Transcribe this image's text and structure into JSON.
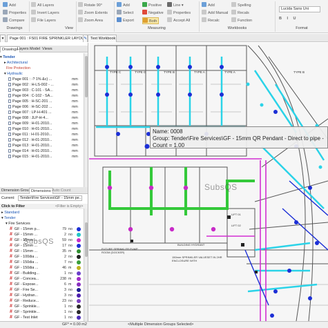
{
  "ribbon": {
    "col1": [
      "Add",
      "Properties",
      "Compare"
    ],
    "col2": [
      "All Layers",
      "Invert Layers",
      "File Layers"
    ],
    "col3": [
      "Rotate 90°",
      "Zoom Extents",
      "Zoom Area"
    ],
    "col4": [
      "Add",
      "Select",
      "Export"
    ],
    "col5": [
      "Positive",
      "Negative",
      "Both"
    ],
    "col6": [
      "Line",
      "Properties",
      "Accept All"
    ],
    "col7": [
      "Add",
      "Add Manual",
      "Recalc"
    ],
    "col8": [
      "Spelling",
      "Recals",
      "Function"
    ],
    "font_name": "Lucida Sans Uni",
    "groups": [
      "Drawings",
      "View",
      "Measuring",
      "Workbooks",
      "Format"
    ]
  },
  "tabs": [
    "Page 001 : FS01 FIRE SPRINKLER LAYOUT G...",
    "Text Workbook"
  ],
  "left_panel": {
    "top_tabs": [
      "Drawings",
      "Layers",
      "Model",
      "Views"
    ],
    "tree": {
      "root": "Tender",
      "folders": [
        "Architectural",
        "Fire Protection",
        "Hydraulic"
      ],
      "pages": [
        {
          "label": "Page 001 : ‑? 1% &c) ...",
          "unit": "mm"
        },
        {
          "label": "Page 002 : H‑LS‑002 ‑ ...",
          "unit": "mm"
        },
        {
          "label": "Page 003 : C‑101 ‑ SA...",
          "unit": "mm"
        },
        {
          "label": "Page 004 : C‑102 ‑ SA...",
          "unit": "mm"
        },
        {
          "label": "Page 005 : H‑SC‑201 ...",
          "unit": "mm"
        },
        {
          "label": "Page 006 : H‑SC‑202 ...",
          "unit": "mm"
        },
        {
          "label": "Page 007 : LP‑H‑401 ...",
          "unit": "mm"
        },
        {
          "label": "Page 008 : JLP‑H‑4...",
          "unit": "mm"
        },
        {
          "label": "Page 009 : H‑01‑2010...",
          "unit": "mm"
        },
        {
          "label": "Page 010 : H‑01‑2010...",
          "unit": "mm"
        },
        {
          "label": "Page 011 : H‑01‑2010...",
          "unit": "mm"
        },
        {
          "label": "Page 012 : H‑01‑2010...",
          "unit": "mm"
        },
        {
          "label": "Page 013 : H‑01‑2010...",
          "unit": "mm"
        },
        {
          "label": "Page 014 : H‑01‑2010...",
          "unit": "mm"
        },
        {
          "label": "Page 015 : H‑01‑2010...",
          "unit": "mm"
        }
      ]
    },
    "bottom_tabs": [
      "Dimension Groups",
      "Dimensions",
      "Auto Count"
    ],
    "current_label": "Current:",
    "current_value": "Tender\\Fire Services\\GF ‑ 15mm pe...",
    "filter_label": "Click to Filter",
    "filter_placeholder": "<Filter is Empty>",
    "dim_tree": {
      "standard": "Standard",
      "tender": "Tender",
      "fire_services": "Fire Services",
      "items": [
        {
          "label": "GF ‑ 15mm p...",
          "count": "79",
          "unit": "no",
          "color": "#1c2fd6"
        },
        {
          "label": "GF ‑ 15mm ...",
          "count": "2",
          "unit": "no",
          "color": "#23c7c7"
        },
        {
          "label": "GF ‑ 15mm ...",
          "count": "59",
          "unit": "no",
          "color": "#c82bc8"
        },
        {
          "label": "GF ‑ 15mm ...",
          "count": "17",
          "unit": "no",
          "color": "#1c2fd6"
        },
        {
          "label": "GF ‑ 15mm ...",
          "count": "35",
          "unit": "m",
          "color": "#2f8e2f"
        },
        {
          "label": "GF ‑ 100dia ...",
          "count": "2",
          "unit": "no",
          "color": "#222222"
        },
        {
          "label": "GF ‑ 150dia ...",
          "count": "7",
          "unit": "no",
          "color": "#3a9e3a"
        },
        {
          "label": "GF ‑ 150dia ...",
          "count": "46",
          "unit": "m",
          "color": "#bfb21f"
        },
        {
          "label": "GF ‑ Building...",
          "count": "1",
          "unit": "no",
          "color": "#6b3ec9"
        },
        {
          "label": "GF ‑ Concea...",
          "count": "238",
          "unit": "m",
          "color": "#a12bc8"
        },
        {
          "label": "GF ‑ Expose...",
          "count": "6",
          "unit": "m",
          "color": "#8a2fc0"
        },
        {
          "label": "GF ‑ Fire Se...",
          "count": "3",
          "unit": "no",
          "color": "#1d1d8f"
        },
        {
          "label": "GF ‑ Hydran...",
          "count": "3",
          "unit": "no",
          "color": "#4b1dad"
        },
        {
          "label": "GF ‑ Reduce...",
          "count": "23",
          "unit": "no",
          "color": "#7b3fbf"
        },
        {
          "label": "GF ‑ Sprinkle...",
          "count": "1",
          "unit": "no",
          "color": "#2a2a2a"
        },
        {
          "label": "GF ‑ Sprinkle...",
          "count": "1",
          "unit": "no",
          "color": "#2a2a2a"
        },
        {
          "label": "GF ‑ Test Inlet",
          "count": "1",
          "unit": "no",
          "color": "#4e2fb8"
        }
      ]
    },
    "watermark": "SubsQS"
  },
  "canvas": {
    "tooltip": {
      "name": "Name: 0008",
      "group": "Group: Tender\\Fire Services\\GF ‑ 15mm QR Pendant ‑ Direct to pipe ‑ Exposed",
      "count": "Count = 1.00"
    },
    "watermark": "SubsQS",
    "room_labels": [
      "TYPE C",
      "TYPE G",
      "TYPE B",
      "TYPE A",
      "TYPE A",
      "TYPE B"
    ],
    "notes": [
      "FUTURE SPRINKLER PUMP ROOM (DOCKER)",
      "BUILDING HYDRANT",
      "150mm SPRINKLER VALVESET IN 2HR ENCLOSURE WITH",
      "LIFT 01",
      "LIFT 02"
    ]
  },
  "status": {
    "left": "GF* = 0.00 m2",
    "center": "<Multiple Dimension Groups Selected>"
  },
  "colors": {
    "cyan": "#2bd3e8",
    "blue": "#1c2fd6",
    "green": "#34c93a",
    "magenta": "#d22fd2"
  }
}
